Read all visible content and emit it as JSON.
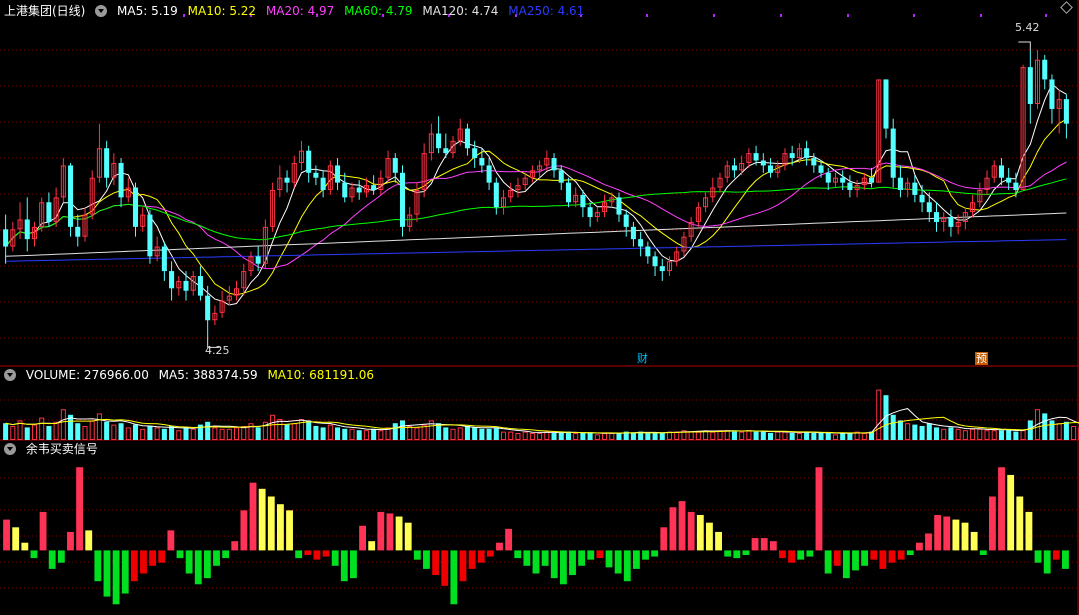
{
  "main_panel": {
    "title": "上港集团(日线)",
    "indicators": [
      {
        "label": "MA5: 5.19",
        "color": "#ffffff"
      },
      {
        "label": "MA10: 5.22",
        "color": "#ffff00"
      },
      {
        "label": "MA20: 4.97",
        "color": "#ff40ff"
      },
      {
        "label": "MA60: 4.79",
        "color": "#00ff00"
      },
      {
        "label": "MA120: 4.74",
        "color": "#e0e0e0"
      },
      {
        "label": "MA250: 4.61",
        "color": "#2b3bff"
      }
    ],
    "high_label": "5.42",
    "low_label": "4.25",
    "badge_finance": "财",
    "badge_forecast": "预"
  },
  "volume_panel": {
    "indicators": [
      {
        "label": "VOLUME: 276966.00",
        "color": "#ffffff"
      },
      {
        "label": "MA5: 388374.59",
        "color": "#ffffff"
      },
      {
        "label": "MA10: 681191.06",
        "color": "#ffff00"
      }
    ]
  },
  "signal_panel": {
    "title": "余韦买卖信号"
  },
  "colors": {
    "up": "#ff3344",
    "down": "#54ffff",
    "grid": "#7a0000",
    "signal_red": "#ff3355",
    "signal_yellow": "#ffff55",
    "signal_green": "#00e020",
    "signal_darkred": "#ee0000"
  },
  "chart_data": {
    "type": "candlestick",
    "price_range": [
      4.15,
      5.55
    ],
    "candles": [
      [
        4.69,
        4.62,
        4.75,
        4.55
      ],
      [
        4.62,
        4.69,
        4.72,
        4.6
      ],
      [
        4.69,
        4.73,
        4.8,
        4.65
      ],
      [
        4.73,
        4.65,
        4.82,
        4.6
      ],
      [
        4.65,
        4.7,
        4.72,
        4.62
      ],
      [
        4.7,
        4.8,
        4.82,
        4.68
      ],
      [
        4.8,
        4.72,
        4.84,
        4.7
      ],
      [
        4.72,
        4.82,
        4.86,
        4.7
      ],
      [
        4.82,
        4.95,
        4.98,
        4.8
      ],
      [
        4.95,
        4.7,
        4.96,
        4.66
      ],
      [
        4.7,
        4.66,
        4.75,
        4.62
      ],
      [
        4.66,
        4.75,
        4.78,
        4.64
      ],
      [
        4.75,
        4.9,
        4.93,
        4.73
      ],
      [
        4.9,
        5.02,
        5.12,
        4.88
      ],
      [
        5.02,
        4.9,
        5.05,
        4.86
      ],
      [
        4.9,
        4.96,
        5.0,
        4.87
      ],
      [
        4.96,
        4.82,
        4.98,
        4.78
      ],
      [
        4.82,
        4.86,
        4.9,
        4.8
      ],
      [
        4.86,
        4.7,
        4.88,
        4.66
      ],
      [
        4.7,
        4.75,
        4.78,
        4.68
      ],
      [
        4.75,
        4.58,
        4.77,
        4.55
      ],
      [
        4.58,
        4.62,
        4.66,
        4.56
      ],
      [
        4.62,
        4.52,
        4.64,
        4.48
      ],
      [
        4.52,
        4.45,
        4.56,
        4.4
      ],
      [
        4.45,
        4.48,
        4.5,
        4.42
      ],
      [
        4.48,
        4.44,
        4.52,
        4.4
      ],
      [
        4.44,
        4.5,
        4.52,
        4.42
      ],
      [
        4.5,
        4.42,
        4.54,
        4.4
      ],
      [
        4.42,
        4.32,
        4.46,
        4.25
      ],
      [
        4.32,
        4.35,
        4.38,
        4.3
      ],
      [
        4.35,
        4.4,
        4.44,
        4.33
      ],
      [
        4.4,
        4.42,
        4.46,
        4.38
      ],
      [
        4.42,
        4.45,
        4.48,
        4.4
      ],
      [
        4.45,
        4.52,
        4.55,
        4.42
      ],
      [
        4.52,
        4.58,
        4.6,
        4.5
      ],
      [
        4.58,
        4.55,
        4.62,
        4.52
      ],
      [
        4.55,
        4.7,
        4.73,
        4.53
      ],
      [
        4.7,
        4.85,
        4.88,
        4.68
      ],
      [
        4.85,
        4.9,
        4.95,
        4.82
      ],
      [
        4.9,
        4.88,
        4.93,
        4.84
      ],
      [
        4.88,
        4.96,
        4.99,
        4.86
      ],
      [
        4.96,
        5.01,
        5.05,
        4.93
      ],
      [
        5.01,
        4.92,
        5.03,
        4.88
      ],
      [
        4.92,
        4.9,
        4.95,
        4.87
      ],
      [
        4.9,
        4.85,
        4.93,
        4.82
      ],
      [
        4.85,
        4.95,
        4.97,
        4.83
      ],
      [
        4.95,
        4.88,
        4.98,
        4.85
      ],
      [
        4.88,
        4.82,
        4.92,
        4.8
      ],
      [
        4.82,
        4.86,
        4.88,
        4.8
      ],
      [
        4.86,
        4.84,
        4.89,
        4.81
      ],
      [
        4.84,
        4.87,
        4.9,
        4.82
      ],
      [
        4.87,
        4.85,
        4.91,
        4.83
      ],
      [
        4.85,
        4.9,
        4.93,
        4.83
      ],
      [
        4.9,
        4.98,
        5.01,
        4.88
      ],
      [
        4.98,
        4.92,
        5.0,
        4.88
      ],
      [
        4.92,
        4.7,
        4.95,
        4.66
      ],
      [
        4.7,
        4.75,
        4.78,
        4.68
      ],
      [
        4.75,
        4.85,
        4.88,
        4.72
      ],
      [
        4.85,
        5.0,
        5.04,
        4.82
      ],
      [
        5.0,
        5.08,
        5.12,
        4.97
      ],
      [
        5.08,
        5.02,
        5.15,
        5.0
      ],
      [
        5.02,
        5.0,
        5.08,
        4.98
      ],
      [
        5.0,
        5.05,
        5.07,
        4.98
      ],
      [
        5.05,
        5.1,
        5.14,
        5.03
      ],
      [
        5.1,
        5.02,
        5.12,
        4.99
      ],
      [
        5.02,
        4.98,
        5.05,
        4.94
      ],
      [
        4.98,
        4.95,
        5.02,
        4.92
      ],
      [
        4.95,
        4.88,
        4.98,
        4.85
      ],
      [
        4.88,
        4.78,
        4.9,
        4.75
      ],
      [
        4.78,
        4.82,
        4.85,
        4.75
      ],
      [
        4.82,
        4.85,
        4.88,
        4.8
      ],
      [
        4.85,
        4.87,
        4.9,
        4.82
      ],
      [
        4.87,
        4.9,
        4.92,
        4.85
      ],
      [
        4.9,
        4.93,
        4.95,
        4.88
      ],
      [
        4.93,
        4.95,
        4.97,
        4.9
      ],
      [
        4.95,
        4.98,
        5.01,
        4.93
      ],
      [
        4.98,
        4.93,
        5.0,
        4.9
      ],
      [
        4.93,
        4.88,
        4.95,
        4.85
      ],
      [
        4.88,
        4.8,
        4.9,
        4.78
      ],
      [
        4.8,
        4.83,
        4.86,
        4.78
      ],
      [
        4.83,
        4.78,
        4.85,
        4.74
      ],
      [
        4.78,
        4.74,
        4.8,
        4.7
      ],
      [
        4.74,
        4.76,
        4.78,
        4.72
      ],
      [
        4.76,
        4.8,
        4.83,
        4.74
      ],
      [
        4.8,
        4.82,
        4.84,
        4.78
      ],
      [
        4.82,
        4.75,
        4.84,
        4.72
      ],
      [
        4.75,
        4.7,
        4.77,
        4.66
      ],
      [
        4.7,
        4.65,
        4.72,
        4.62
      ],
      [
        4.65,
        4.62,
        4.68,
        4.58
      ],
      [
        4.62,
        4.58,
        4.64,
        4.55
      ],
      [
        4.58,
        4.54,
        4.6,
        4.5
      ],
      [
        4.54,
        4.52,
        4.57,
        4.48
      ],
      [
        4.52,
        4.56,
        4.58,
        4.5
      ],
      [
        4.56,
        4.6,
        4.62,
        4.54
      ],
      [
        4.6,
        4.66,
        4.68,
        4.58
      ],
      [
        4.66,
        4.72,
        4.74,
        4.64
      ],
      [
        4.72,
        4.78,
        4.8,
        4.7
      ],
      [
        4.78,
        4.82,
        4.84,
        4.76
      ],
      [
        4.82,
        4.86,
        4.9,
        4.8
      ],
      [
        4.86,
        4.9,
        4.92,
        4.84
      ],
      [
        4.9,
        4.95,
        4.97,
        4.88
      ],
      [
        4.95,
        4.93,
        4.98,
        4.9
      ],
      [
        4.93,
        4.96,
        4.99,
        4.91
      ],
      [
        4.96,
        5.0,
        5.02,
        4.94
      ],
      [
        5.0,
        4.97,
        5.03,
        4.95
      ],
      [
        4.97,
        4.95,
        5.0,
        4.92
      ],
      [
        4.95,
        4.92,
        4.98,
        4.9
      ],
      [
        4.92,
        4.95,
        4.97,
        4.9
      ],
      [
        4.95,
        5.0,
        5.02,
        4.93
      ],
      [
        5.0,
        4.98,
        5.03,
        4.95
      ],
      [
        4.98,
        5.02,
        5.04,
        4.96
      ],
      [
        5.02,
        4.98,
        5.05,
        4.95
      ],
      [
        4.98,
        4.95,
        5.0,
        4.92
      ],
      [
        4.95,
        4.92,
        4.97,
        4.9
      ],
      [
        4.92,
        4.88,
        4.94,
        4.85
      ],
      [
        4.88,
        4.9,
        4.92,
        4.86
      ],
      [
        4.9,
        4.88,
        4.93,
        4.85
      ],
      [
        4.88,
        4.85,
        4.91,
        4.82
      ],
      [
        4.85,
        4.87,
        4.89,
        4.82
      ],
      [
        4.87,
        4.9,
        4.92,
        4.85
      ],
      [
        4.9,
        4.88,
        4.94,
        4.86
      ],
      [
        4.88,
        5.3,
        5.3,
        4.88
      ],
      [
        5.3,
        5.1,
        5.3,
        5.06
      ],
      [
        5.1,
        4.9,
        5.14,
        4.86
      ],
      [
        4.9,
        4.85,
        4.95,
        4.82
      ],
      [
        4.85,
        4.88,
        4.9,
        4.82
      ],
      [
        4.88,
        4.83,
        4.91,
        4.8
      ],
      [
        4.83,
        4.8,
        4.87,
        4.76
      ],
      [
        4.8,
        4.76,
        4.84,
        4.72
      ],
      [
        4.76,
        4.72,
        4.8,
        4.68
      ],
      [
        4.72,
        4.74,
        4.76,
        4.68
      ],
      [
        4.74,
        4.7,
        4.77,
        4.66
      ],
      [
        4.7,
        4.72,
        4.75,
        4.67
      ],
      [
        4.72,
        4.76,
        4.78,
        4.69
      ],
      [
        4.76,
        4.8,
        4.83,
        4.74
      ],
      [
        4.8,
        4.85,
        4.88,
        4.78
      ],
      [
        4.85,
        4.9,
        4.93,
        4.83
      ],
      [
        4.9,
        4.95,
        4.97,
        4.88
      ],
      [
        4.95,
        4.9,
        4.98,
        4.87
      ],
      [
        4.9,
        4.88,
        4.94,
        4.85
      ],
      [
        4.88,
        4.85,
        4.92,
        4.82
      ],
      [
        4.85,
        5.35,
        5.36,
        4.85
      ],
      [
        5.35,
        5.2,
        5.42,
        5.12
      ],
      [
        5.2,
        5.38,
        5.42,
        5.18
      ],
      [
        5.38,
        5.3,
        5.4,
        5.26
      ],
      [
        5.3,
        5.18,
        5.32,
        5.12
      ],
      [
        5.18,
        5.22,
        5.26,
        5.08
      ],
      [
        5.22,
        5.12,
        5.24,
        5.06
      ]
    ],
    "volume": [
      12,
      10,
      14,
      9,
      11,
      16,
      10,
      13,
      22,
      18,
      12,
      10,
      14,
      19,
      13,
      11,
      12,
      9,
      11,
      8,
      10,
      9,
      8,
      10,
      7,
      9,
      8,
      11,
      13,
      9,
      8,
      8,
      9,
      10,
      12,
      9,
      13,
      18,
      15,
      11,
      12,
      15,
      14,
      10,
      9,
      11,
      9,
      8,
      8,
      7,
      7,
      8,
      7,
      9,
      12,
      14,
      10,
      9,
      11,
      14,
      12,
      9,
      8,
      9,
      10,
      9,
      8,
      8,
      9,
      6,
      6,
      5,
      6,
      5,
      5,
      6,
      5,
      5,
      6,
      5,
      5,
      5,
      4,
      5,
      5,
      5,
      6,
      5,
      6,
      5,
      5,
      5,
      6,
      6,
      7,
      6,
      6,
      7,
      6,
      7,
      7,
      6,
      6,
      7,
      6,
      6,
      5,
      6,
      6,
      5,
      5,
      6,
      5,
      5,
      5,
      4,
      5,
      5,
      6,
      5,
      6,
      36,
      32,
      18,
      14,
      12,
      11,
      10,
      12,
      9,
      8,
      9,
      8,
      7,
      8,
      8,
      7,
      7,
      7,
      7,
      6,
      7,
      14,
      22,
      19,
      14,
      12,
      13,
      10,
      9
    ],
    "volume_range": [
      0,
      40
    ],
    "signal": [
      [
        2,
        "red"
      ],
      [
        1.5,
        "yellow"
      ],
      [
        0.5,
        "yellow"
      ],
      [
        -0.5,
        "green"
      ],
      [
        2.5,
        "red"
      ],
      [
        -1.2,
        "green"
      ],
      [
        -0.8,
        "green"
      ],
      [
        1.2,
        "red"
      ],
      [
        5.4,
        "red"
      ],
      [
        1.3,
        "yellow"
      ],
      [
        -2.0,
        "green"
      ],
      [
        -3.0,
        "green"
      ],
      [
        -3.5,
        "green"
      ],
      [
        -2.8,
        "green"
      ],
      [
        -2.0,
        "darkred"
      ],
      [
        -1.5,
        "darkred"
      ],
      [
        -1.0,
        "darkred"
      ],
      [
        -0.8,
        "darkred"
      ],
      [
        1.3,
        "red"
      ],
      [
        -0.5,
        "green"
      ],
      [
        -1.5,
        "green"
      ],
      [
        -2.2,
        "green"
      ],
      [
        -1.8,
        "green"
      ],
      [
        -1.0,
        "green"
      ],
      [
        -0.5,
        "green"
      ],
      [
        0.6,
        "red"
      ],
      [
        2.6,
        "red"
      ],
      [
        4.4,
        "red"
      ],
      [
        4.0,
        "yellow"
      ],
      [
        3.5,
        "yellow"
      ],
      [
        3.0,
        "yellow"
      ],
      [
        2.6,
        "yellow"
      ],
      [
        -0.5,
        "green"
      ],
      [
        -0.3,
        "darkred"
      ],
      [
        -0.6,
        "darkred"
      ],
      [
        -0.4,
        "darkred"
      ],
      [
        -1.0,
        "green"
      ],
      [
        -2.0,
        "green"
      ],
      [
        -1.8,
        "green"
      ],
      [
        1.6,
        "red"
      ],
      [
        0.6,
        "yellow"
      ],
      [
        2.5,
        "red"
      ],
      [
        2.4,
        "red"
      ],
      [
        2.2,
        "yellow"
      ],
      [
        1.8,
        "yellow"
      ],
      [
        -0.6,
        "green"
      ],
      [
        -1.2,
        "green"
      ],
      [
        -1.6,
        "darkred"
      ],
      [
        -2.3,
        "darkred"
      ],
      [
        -3.5,
        "green"
      ],
      [
        -2.0,
        "darkred"
      ],
      [
        -1.2,
        "darkred"
      ],
      [
        -0.8,
        "darkred"
      ],
      [
        -0.4,
        "darkred"
      ],
      [
        0.5,
        "red"
      ],
      [
        1.4,
        "red"
      ],
      [
        -0.5,
        "green"
      ],
      [
        -1.0,
        "green"
      ],
      [
        -1.5,
        "green"
      ],
      [
        -1.0,
        "green"
      ],
      [
        -1.8,
        "green"
      ],
      [
        -2.2,
        "green"
      ],
      [
        -1.6,
        "green"
      ],
      [
        -1.0,
        "green"
      ],
      [
        -0.6,
        "green"
      ],
      [
        -0.5,
        "darkred"
      ],
      [
        -1.1,
        "green"
      ],
      [
        -1.5,
        "green"
      ],
      [
        -2.0,
        "green"
      ],
      [
        -1.2,
        "green"
      ],
      [
        -0.6,
        "green"
      ],
      [
        -0.4,
        "green"
      ],
      [
        1.5,
        "red"
      ],
      [
        2.8,
        "red"
      ],
      [
        3.2,
        "red"
      ],
      [
        2.5,
        "red"
      ],
      [
        2.3,
        "yellow"
      ],
      [
        1.8,
        "yellow"
      ],
      [
        1.2,
        "yellow"
      ],
      [
        -0.4,
        "green"
      ],
      [
        -0.5,
        "green"
      ],
      [
        -0.3,
        "green"
      ],
      [
        0.8,
        "red"
      ],
      [
        0.8,
        "red"
      ],
      [
        0.6,
        "red"
      ],
      [
        -0.5,
        "darkred"
      ],
      [
        -0.8,
        "darkred"
      ],
      [
        -0.6,
        "green"
      ],
      [
        -0.4,
        "green"
      ],
      [
        5.4,
        "red"
      ],
      [
        -1.5,
        "green"
      ],
      [
        -1.0,
        "darkred"
      ],
      [
        -1.8,
        "green"
      ],
      [
        -1.3,
        "green"
      ],
      [
        -1.0,
        "green"
      ],
      [
        -0.6,
        "darkred"
      ],
      [
        -1.2,
        "darkred"
      ],
      [
        -0.8,
        "darkred"
      ],
      [
        -0.6,
        "darkred"
      ],
      [
        -0.3,
        "green"
      ],
      [
        0.5,
        "red"
      ],
      [
        1.1,
        "red"
      ],
      [
        2.3,
        "red"
      ],
      [
        2.2,
        "red"
      ],
      [
        2.0,
        "yellow"
      ],
      [
        1.8,
        "yellow"
      ],
      [
        1.2,
        "yellow"
      ],
      [
        -0.3,
        "green"
      ],
      [
        3.5,
        "red"
      ],
      [
        5.4,
        "red"
      ],
      [
        4.9,
        "yellow"
      ],
      [
        3.5,
        "yellow"
      ],
      [
        2.5,
        "yellow"
      ],
      [
        -0.8,
        "green"
      ],
      [
        -1.5,
        "green"
      ],
      [
        -0.6,
        "darkred"
      ],
      [
        -1.2,
        "green"
      ]
    ],
    "signal_range": [
      -4.0,
      6.0
    ]
  }
}
